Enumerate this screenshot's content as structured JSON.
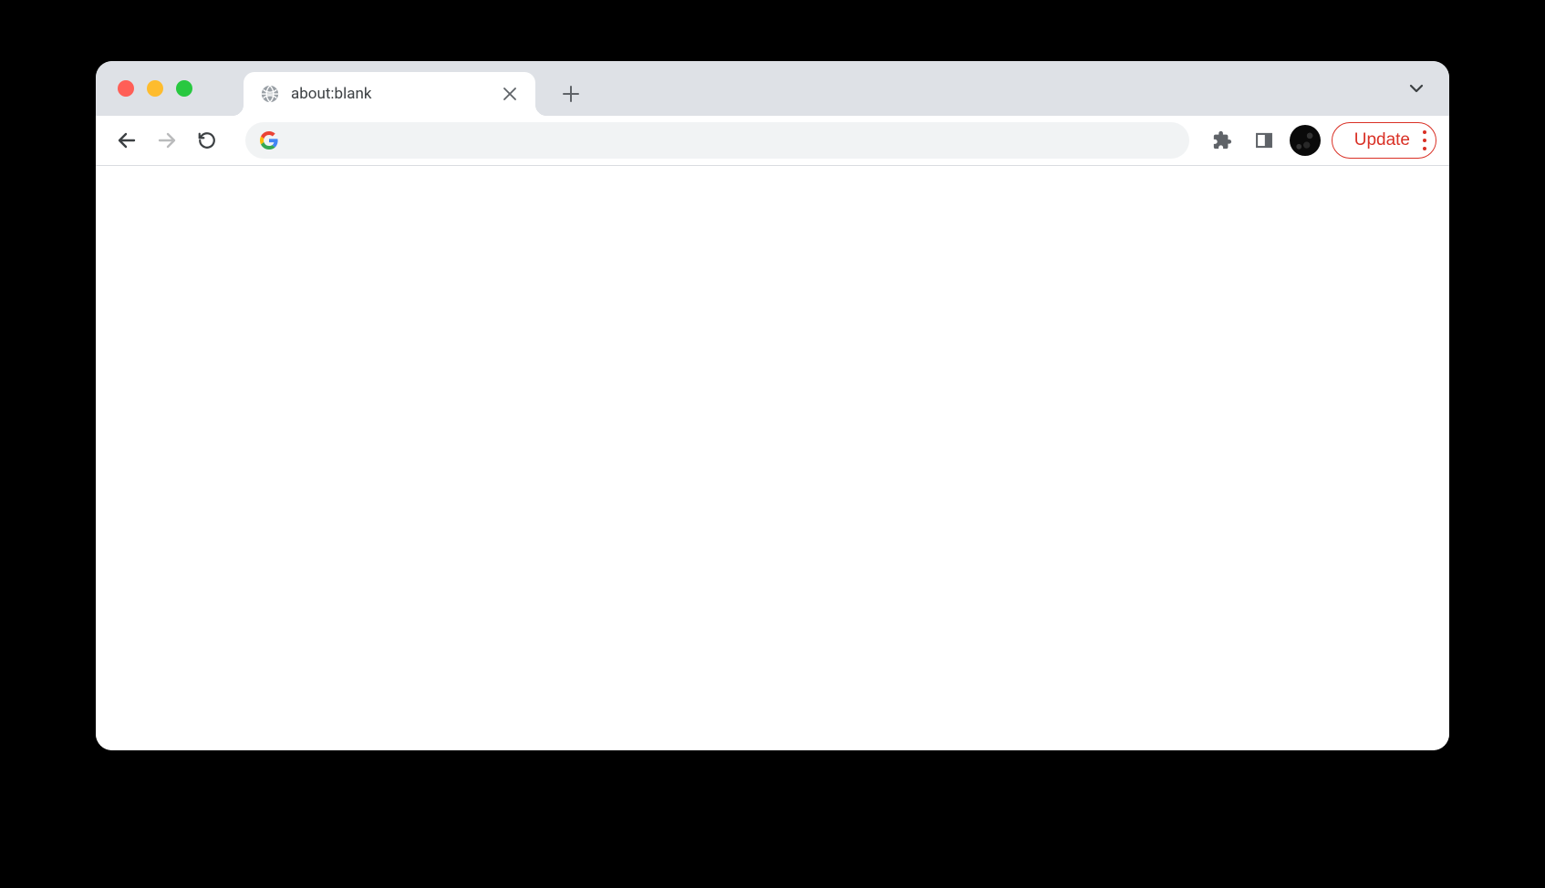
{
  "window": {
    "trafficLights": {
      "close": "#ff5f57",
      "minimize": "#febc2e",
      "maximize": "#28c840"
    }
  },
  "tabs": [
    {
      "title": "about:blank",
      "favicon": "globe"
    }
  ],
  "toolbar": {
    "addressBarValue": "",
    "updateLabel": "Update"
  },
  "colors": {
    "tabBarBg": "#dee1e6",
    "updateAccent": "#d93025"
  }
}
